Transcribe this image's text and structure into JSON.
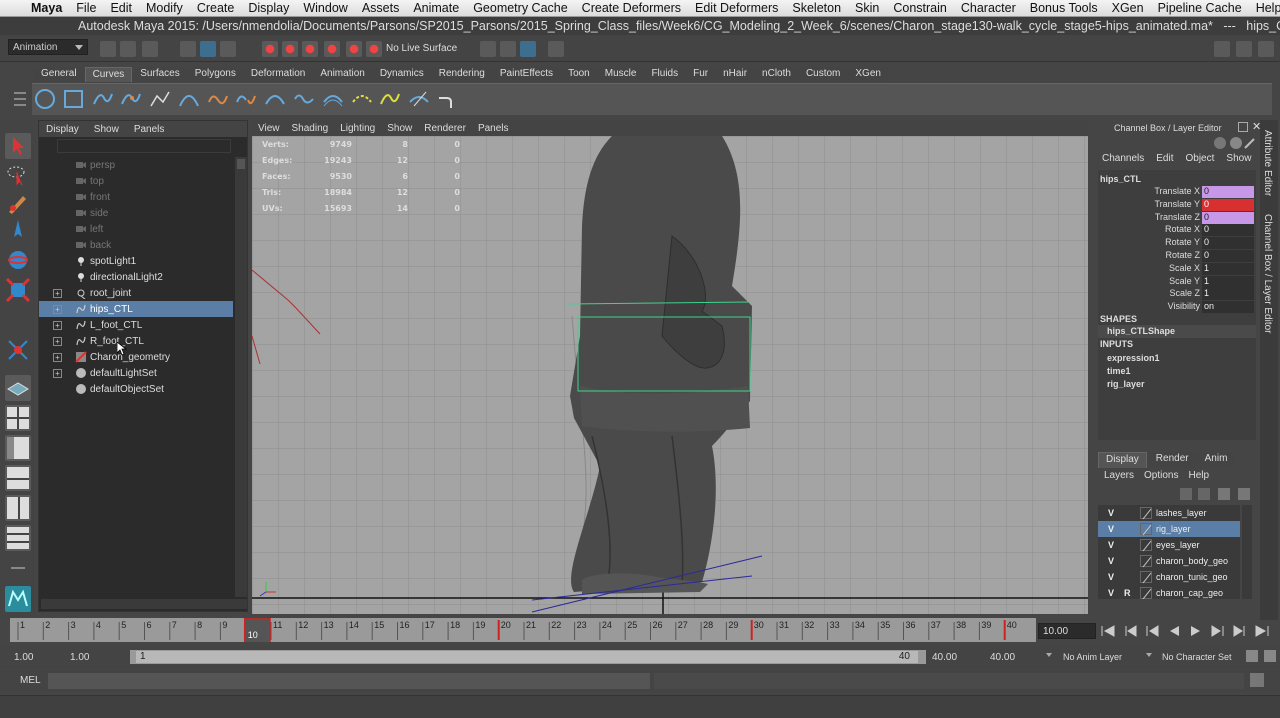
{
  "macmenu": {
    "app": "Maya",
    "items": [
      "File",
      "Edit",
      "Modify",
      "Create",
      "Display",
      "Window",
      "Assets",
      "Animate",
      "Geometry Cache",
      "Create Deformers",
      "Edit Deformers",
      "Skeleton",
      "Skin",
      "Constrain",
      "Character",
      "Bonus Tools",
      "XGen",
      "Pipeline Cache",
      "Help"
    ]
  },
  "title": "Autodesk Maya 2015: /Users/nmendolia/Documents/Parsons/SP2015_Parsons/2015_Spring_Class_files/Week6/CG_Modeling_2_Week_6/scenes/Charon_stage130-walk_cycle_stage5-hips_animated.ma*   ---   hips_CTL",
  "status": {
    "menuset": "Animation",
    "live_surface": "No Live Surface"
  },
  "shelf_tabs": [
    {
      "label": "General",
      "active": false
    },
    {
      "label": "Curves",
      "active": true
    },
    {
      "label": "Surfaces",
      "active": false
    },
    {
      "label": "Polygons",
      "active": false
    },
    {
      "label": "Deformation",
      "active": false
    },
    {
      "label": "Animation",
      "active": false
    },
    {
      "label": "Dynamics",
      "active": false
    },
    {
      "label": "Rendering",
      "active": false
    },
    {
      "label": "PaintEffects",
      "active": false
    },
    {
      "label": "Toon",
      "active": false
    },
    {
      "label": "Muscle",
      "active": false
    },
    {
      "label": "Fluids",
      "active": false
    },
    {
      "label": "Fur",
      "active": false
    },
    {
      "label": "nHair",
      "active": false
    },
    {
      "label": "nCloth",
      "active": false
    },
    {
      "label": "Custom",
      "active": false
    },
    {
      "label": "XGen",
      "active": false
    }
  ],
  "outliner": {
    "menu": [
      "Display",
      "Show",
      "Panels"
    ],
    "rows": [
      {
        "label": "persp",
        "dim": true,
        "expand": false,
        "icon": "camera-icon"
      },
      {
        "label": "top",
        "dim": true,
        "expand": false,
        "icon": "camera-icon"
      },
      {
        "label": "front",
        "dim": true,
        "expand": false,
        "icon": "camera-icon"
      },
      {
        "label": "side",
        "dim": true,
        "expand": false,
        "icon": "camera-icon"
      },
      {
        "label": "left",
        "dim": true,
        "expand": false,
        "icon": "camera-icon"
      },
      {
        "label": "back",
        "dim": true,
        "expand": false,
        "icon": "camera-icon"
      },
      {
        "label": "spotLight1",
        "dim": false,
        "expand": false,
        "icon": "spot-light-icon"
      },
      {
        "label": "directionalLight2",
        "dim": false,
        "expand": false,
        "icon": "directional-light-icon"
      },
      {
        "label": "root_joint",
        "dim": false,
        "expand": true,
        "icon": "joint-icon"
      },
      {
        "label": "hips_CTL",
        "dim": false,
        "expand": true,
        "icon": "curve-control-icon",
        "selected": true
      },
      {
        "label": "L_foot_CTL",
        "dim": false,
        "expand": true,
        "icon": "curve-icon"
      },
      {
        "label": "R_foot_CTL",
        "dim": false,
        "expand": true,
        "icon": "curve-icon"
      },
      {
        "label": "Charon_geometry",
        "dim": false,
        "expand": true,
        "icon": "geometry-group-icon"
      },
      {
        "label": "defaultLightSet",
        "dim": false,
        "expand": true,
        "icon": "set-icon"
      },
      {
        "label": "defaultObjectSet",
        "dim": false,
        "expand": false,
        "icon": "set-icon"
      }
    ]
  },
  "viewport": {
    "menu": [
      "View",
      "Shading",
      "Lighting",
      "Show",
      "Renderer",
      "Panels"
    ],
    "hud": [
      {
        "label": "Verts:",
        "a": "9749",
        "b": "8",
        "c": "0"
      },
      {
        "label": "Edges:",
        "a": "19243",
        "b": "12",
        "c": "0"
      },
      {
        "label": "Faces:",
        "a": "9530",
        "b": "6",
        "c": "0"
      },
      {
        "label": "Tris:",
        "a": "18984",
        "b": "12",
        "c": "0"
      },
      {
        "label": "UVs:",
        "a": "15693",
        "b": "14",
        "c": "0"
      }
    ]
  },
  "channelbox": {
    "header": "Channel Box / Layer Editor",
    "menu": [
      "Channels",
      "Edit",
      "Object",
      "Show"
    ],
    "object": "hips_CTL",
    "channels": [
      {
        "label": "Translate X",
        "value": "0",
        "style": "purple"
      },
      {
        "label": "Translate Y",
        "value": "0",
        "style": "red"
      },
      {
        "label": "Translate Z",
        "value": "0",
        "style": "purple"
      },
      {
        "label": "Rotate X",
        "value": "0",
        "style": ""
      },
      {
        "label": "Rotate Y",
        "value": "0",
        "style": ""
      },
      {
        "label": "Rotate Z",
        "value": "0",
        "style": ""
      },
      {
        "label": "Scale X",
        "value": "1",
        "style": ""
      },
      {
        "label": "Scale Y",
        "value": "1",
        "style": ""
      },
      {
        "label": "Scale Z",
        "value": "1",
        "style": ""
      },
      {
        "label": "Visibility",
        "value": "on",
        "style": ""
      }
    ],
    "shapes_label": "SHAPES",
    "shapes": [
      "hips_CTLShape"
    ],
    "inputs_label": "INPUTS",
    "inputs": [
      "expression1",
      "time1",
      "rig_layer"
    ]
  },
  "side_tabs": [
    "Attribute Editor",
    "Channel Box / Layer Editor"
  ],
  "layer_editor": {
    "tabs": [
      {
        "label": "Display",
        "active": true
      },
      {
        "label": "Render",
        "active": false
      },
      {
        "label": "Anim",
        "active": false
      }
    ],
    "menu": [
      "Layers",
      "Options",
      "Help"
    ],
    "layers": [
      {
        "v": "V",
        "p": "",
        "name": "lashes_layer",
        "selected": false
      },
      {
        "v": "V",
        "p": "",
        "name": "rig_layer",
        "selected": true
      },
      {
        "v": "V",
        "p": "",
        "name": "eyes_layer",
        "selected": false
      },
      {
        "v": "V",
        "p": "",
        "name": "charon_body_geo",
        "selected": false
      },
      {
        "v": "V",
        "p": "",
        "name": "charon_tunic_geo",
        "selected": false
      },
      {
        "v": "V",
        "p": "R",
        "name": "charon_cap_geo",
        "selected": false
      }
    ]
  },
  "timeline": {
    "ticks": [
      "1",
      "2",
      "3",
      "4",
      "5",
      "6",
      "7",
      "8",
      "9",
      "10",
      "11",
      "12",
      "13",
      "14",
      "15",
      "16",
      "17",
      "18",
      "19",
      "20",
      "21",
      "22",
      "23",
      "24",
      "25",
      "26",
      "27",
      "28",
      "29",
      "30",
      "31",
      "32",
      "33",
      "34",
      "35",
      "36",
      "37",
      "38",
      "39",
      "40"
    ],
    "current_frame": "10.00",
    "current_marker": "10",
    "key_frames": [
      20,
      30,
      40
    ]
  },
  "range": {
    "start": "1.00",
    "start_inner": "1.00",
    "slider_left": "1",
    "slider_right": "40",
    "end_inner": "40.00",
    "end": "40.00",
    "anim_layer": "No Anim Layer",
    "char_set": "No Character Set"
  },
  "cmdline": {
    "label": "MEL"
  }
}
